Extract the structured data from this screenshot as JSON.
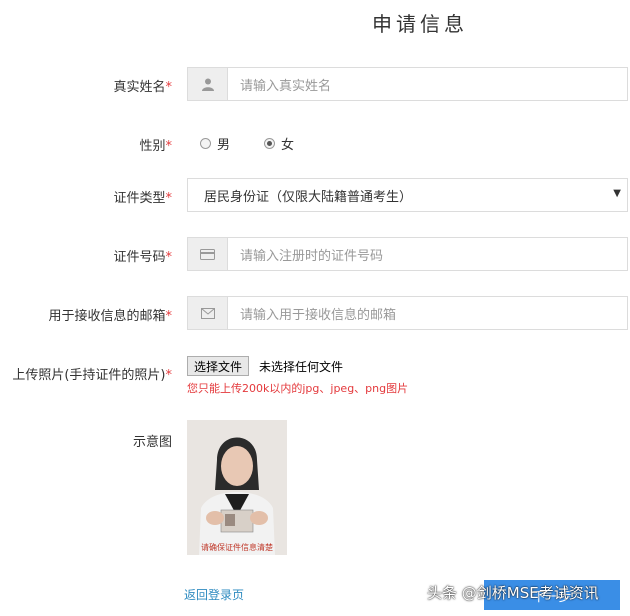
{
  "title": "申请信息",
  "required_mark": "*",
  "fields": {
    "name": {
      "label": "真实姓名",
      "placeholder": "请输入真实姓名"
    },
    "gender": {
      "label": "性别",
      "options": [
        "男",
        "女"
      ],
      "selected": "女"
    },
    "id_type": {
      "label": "证件类型",
      "value": "居民身份证（仅限大陆籍普通考生）"
    },
    "id_number": {
      "label": "证件号码",
      "placeholder": "请输入注册时的证件号码"
    },
    "email": {
      "label": "用于接收信息的邮箱",
      "placeholder": "请输入用于接收信息的邮箱"
    },
    "photo": {
      "label": "上传照片(手持证件的照片)",
      "button": "选择文件",
      "status": "未选择任何文件",
      "hint": "您只能上传200k以内的jpg、jpeg、png图片"
    },
    "sample": {
      "label": "示意图",
      "caption": "请确保证件信息清楚"
    }
  },
  "footer": {
    "back_link": "返回登录页",
    "submit": "下一步",
    "watermark": "头条 @剑桥MSE考试资讯"
  },
  "colors": {
    "required": "#e4393c",
    "link": "#2e8bc0",
    "submit_bg": "#3a8ee6"
  },
  "icons": {
    "name": "user-icon",
    "id_number": "id-card-icon",
    "email": "envelope-icon",
    "select": "caret-down-icon"
  }
}
